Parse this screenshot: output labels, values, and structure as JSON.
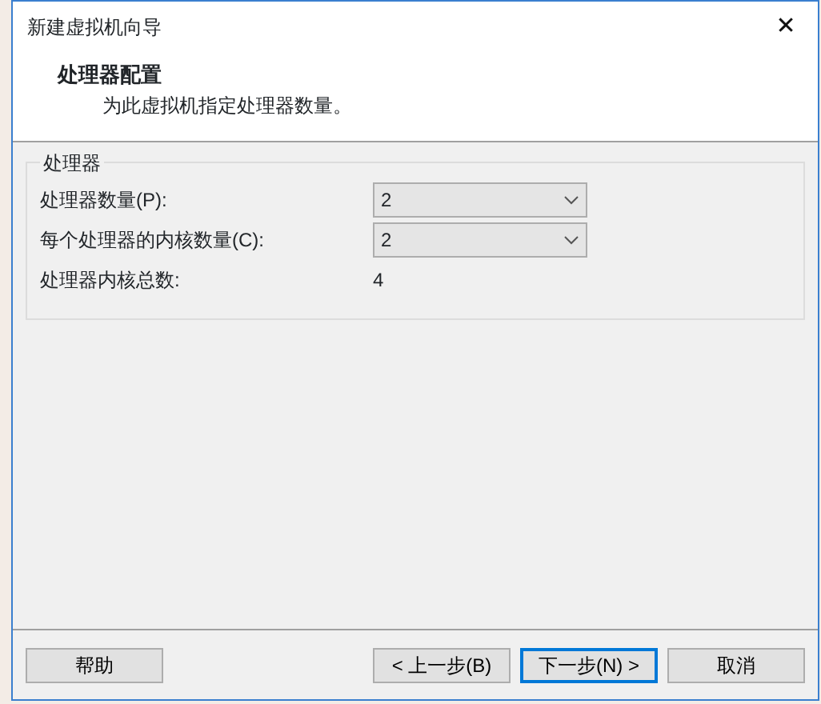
{
  "window": {
    "title": "新建虚拟机向导",
    "close": "✕"
  },
  "header": {
    "title": "处理器配置",
    "subtitle": "为此虚拟机指定处理器数量。"
  },
  "group": {
    "title": "处理器",
    "rows": [
      {
        "kind": "select",
        "label": "处理器数量(P):",
        "value": "2"
      },
      {
        "kind": "select",
        "label": "每个处理器的内核数量(C):",
        "value": "2"
      },
      {
        "kind": "text",
        "label": "处理器内核总数:",
        "value": "4"
      }
    ]
  },
  "left_buttons": [
    {
      "label": "帮助",
      "focused": false
    }
  ],
  "buttons": [
    {
      "label": "< 上一步(B)",
      "focused": false
    },
    {
      "label": "下一步(N) >",
      "focused": true
    },
    {
      "label": "取消",
      "focused": false
    }
  ]
}
